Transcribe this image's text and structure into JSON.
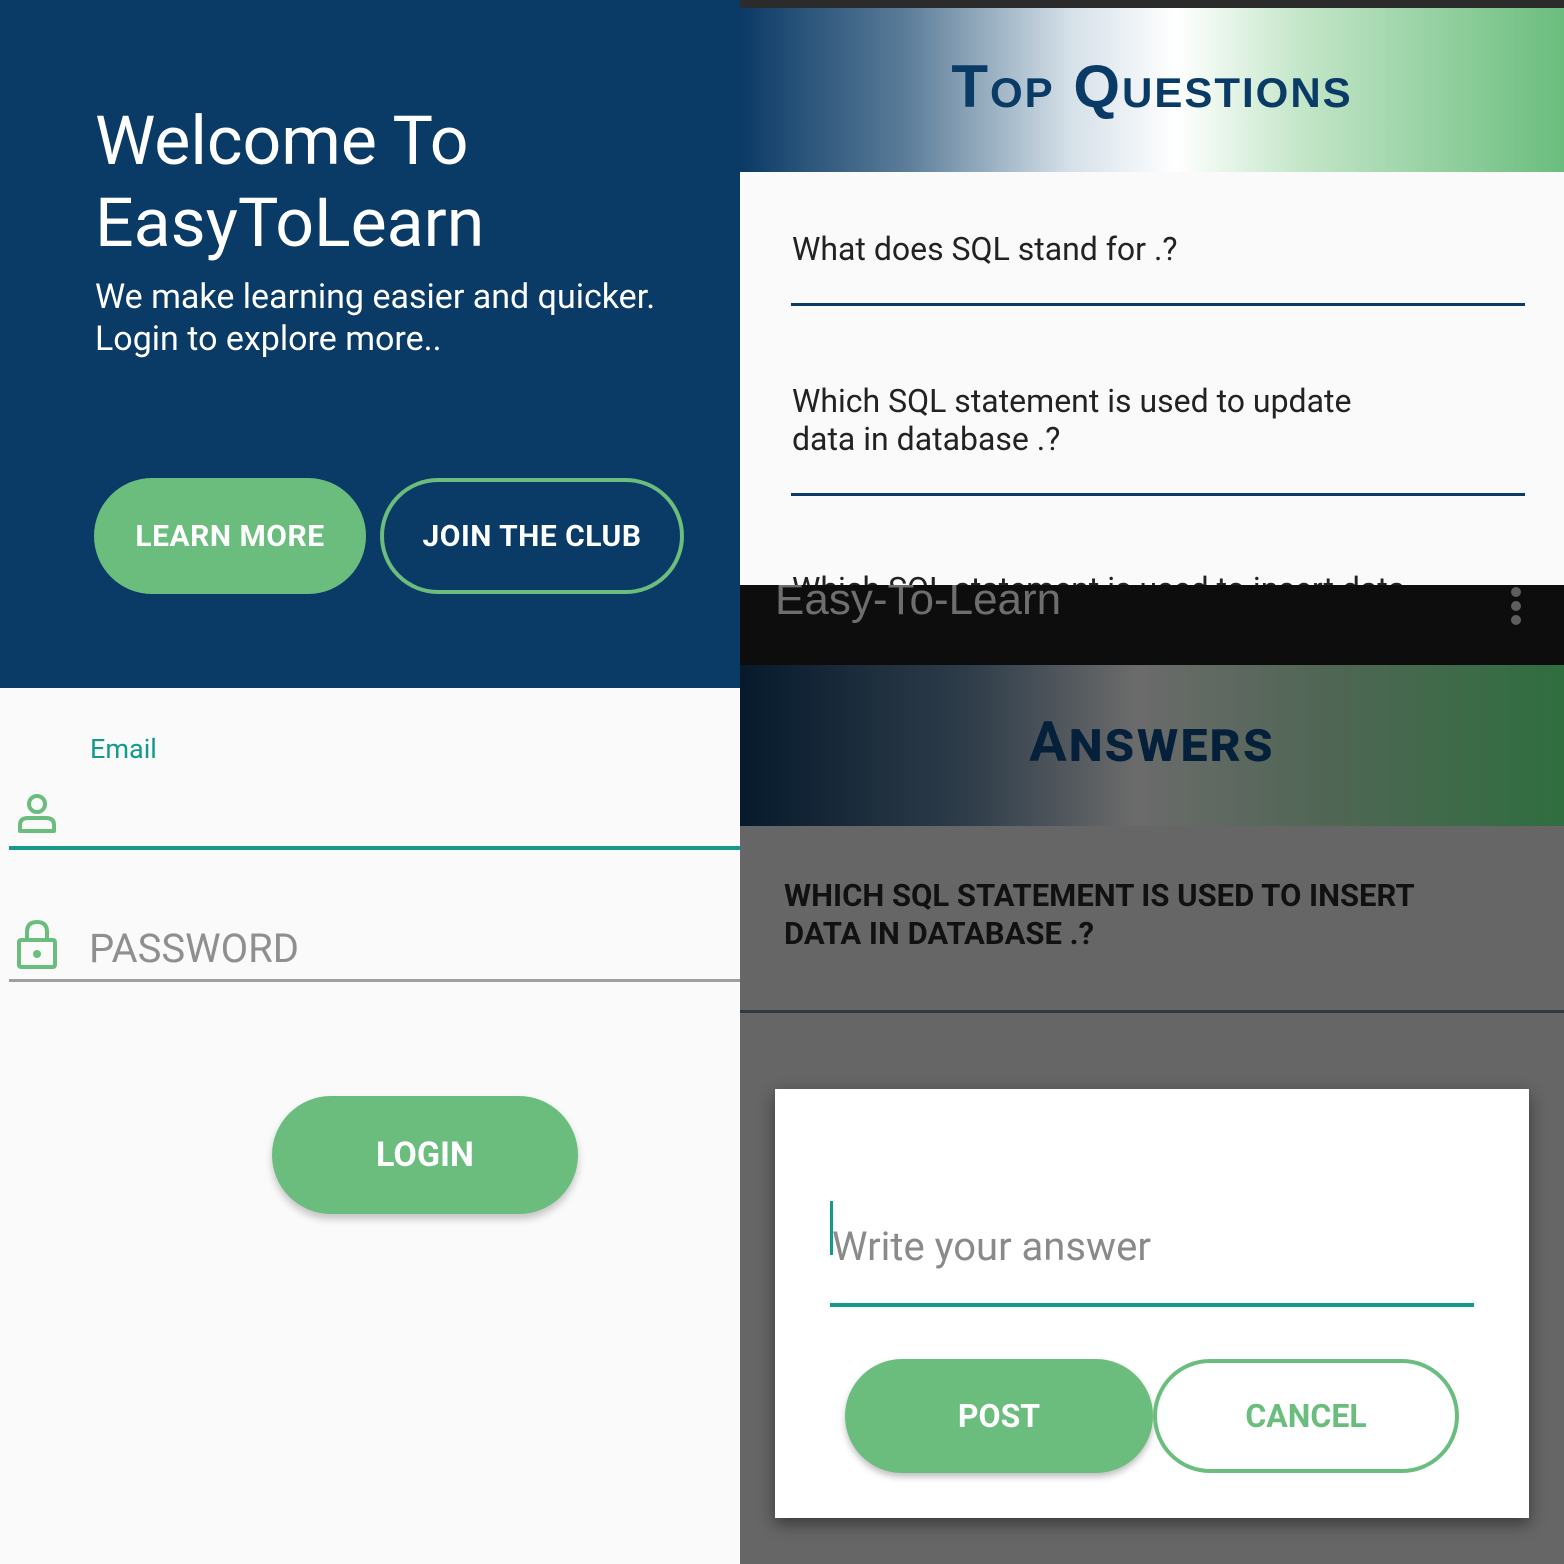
{
  "login_screen": {
    "hero": {
      "title_line1": "Welcome To",
      "title_line2": "EasyToLearn",
      "subtitle_line1": "We make learning easier and quicker.",
      "subtitle_line2": "Login to explore more..",
      "learn_more_label": "LEARN MORE",
      "join_club_label": "JOIN THE CLUB"
    },
    "email": {
      "label": "Email",
      "value": "",
      "icon": "person-icon"
    },
    "password": {
      "placeholder": "PASSWORD",
      "icon": "lock-icon"
    },
    "login_label": "LOGIN",
    "colors": {
      "primary_dark": "#0a3a66",
      "accent_green": "#6abd7d",
      "teal": "#139a8d"
    }
  },
  "top_questions_screen": {
    "title": "Top Questions",
    "questions": [
      {
        "line1": "What does SQL stand for .?",
        "line2": ""
      },
      {
        "line1": "Which SQL statement is used to update",
        "line2": "data in database .?"
      },
      {
        "line1": "Which SQL statement is used to insert data",
        "line2": ""
      }
    ]
  },
  "answers_screen": {
    "app_title": "Easy-To-Learn",
    "overflow_icon": "more-vert-icon",
    "title": "Answers",
    "question_line1": "WHICH SQL STATEMENT IS USED TO INSERT",
    "question_line2": "DATA IN DATABASE .?",
    "dialog": {
      "answer_placeholder": "Write your answer",
      "post_label": "POST",
      "cancel_label": "CANCEL"
    }
  }
}
